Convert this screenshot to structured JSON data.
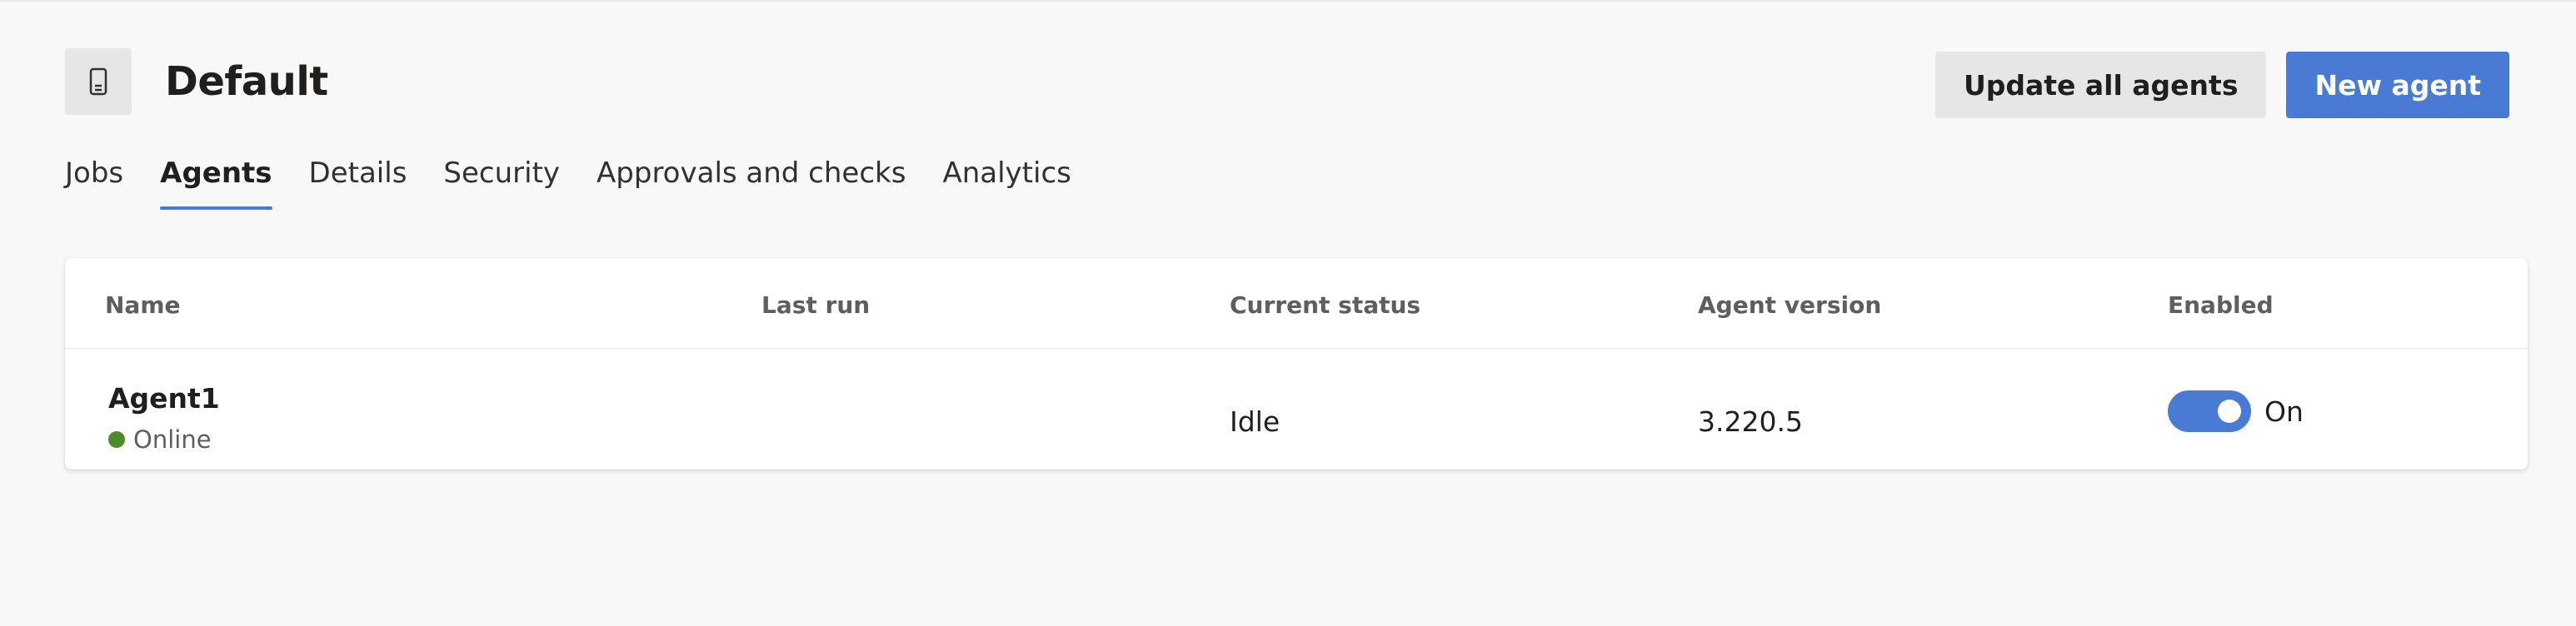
{
  "header": {
    "title": "Default",
    "icon": "mobile-device-icon"
  },
  "actions": {
    "update_label": "Update all agents",
    "new_label": "New agent"
  },
  "tabs": [
    {
      "label": "Jobs",
      "active": false
    },
    {
      "label": "Agents",
      "active": true
    },
    {
      "label": "Details",
      "active": false
    },
    {
      "label": "Security",
      "active": false
    },
    {
      "label": "Approvals and checks",
      "active": false
    },
    {
      "label": "Analytics",
      "active": false
    }
  ],
  "table": {
    "columns": [
      "Name",
      "Last run",
      "Current status",
      "Agent version",
      "Enabled"
    ],
    "rows": [
      {
        "name": "Agent1",
        "state": "Online",
        "last_run": "",
        "status": "Idle",
        "version": "3.220.5",
        "enabled": true,
        "enabled_label": "On"
      }
    ]
  },
  "colors": {
    "accent": "#4a7bd4",
    "online": "#4b8b2b",
    "background": "#f8f8f8"
  }
}
